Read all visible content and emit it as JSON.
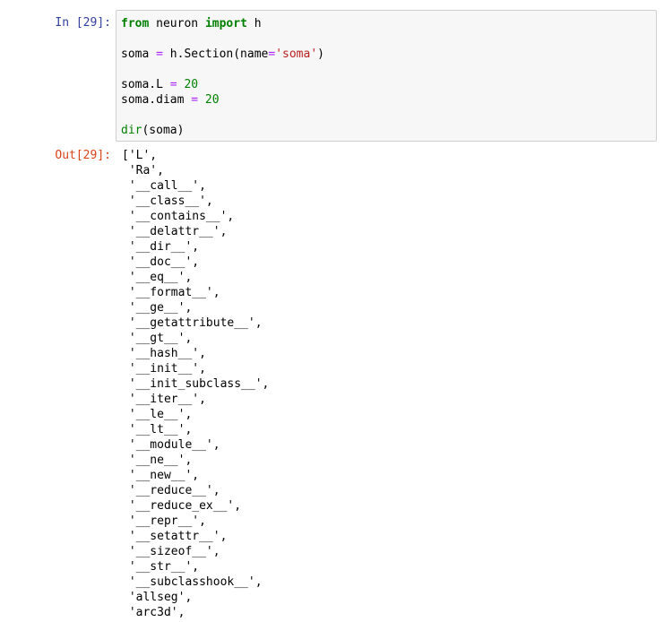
{
  "input_cell": {
    "prompt": "In [29]:",
    "line1": {
      "kw_from": "from",
      "module": " neuron ",
      "kw_import": "import",
      "name": " h"
    },
    "line3": {
      "lhs": "soma ",
      "eq": "=",
      "rhs_a": " h.Section(name",
      "eq2": "=",
      "str": "'soma'",
      "close": ")"
    },
    "line5": {
      "lhs": "soma.L ",
      "eq": "=",
      "num": " 20"
    },
    "line6": {
      "lhs": "soma.diam ",
      "eq": "=",
      "num": " 20"
    },
    "line8": {
      "fn": "dir",
      "rest": "(soma)"
    }
  },
  "output_cell": {
    "prompt": "Out[29]:",
    "lines": [
      "['L',",
      " 'Ra',",
      " '__call__',",
      " '__class__',",
      " '__contains__',",
      " '__delattr__',",
      " '__dir__',",
      " '__doc__',",
      " '__eq__',",
      " '__format__',",
      " '__ge__',",
      " '__getattribute__',",
      " '__gt__',",
      " '__hash__',",
      " '__init__',",
      " '__init_subclass__',",
      " '__iter__',",
      " '__le__',",
      " '__lt__',",
      " '__module__',",
      " '__ne__',",
      " '__new__',",
      " '__reduce__',",
      " '__reduce_ex__',",
      " '__repr__',",
      " '__setattr__',",
      " '__sizeof__',",
      " '__str__',",
      " '__subclasshook__',",
      " 'allseg',",
      " 'arc3d',"
    ]
  }
}
